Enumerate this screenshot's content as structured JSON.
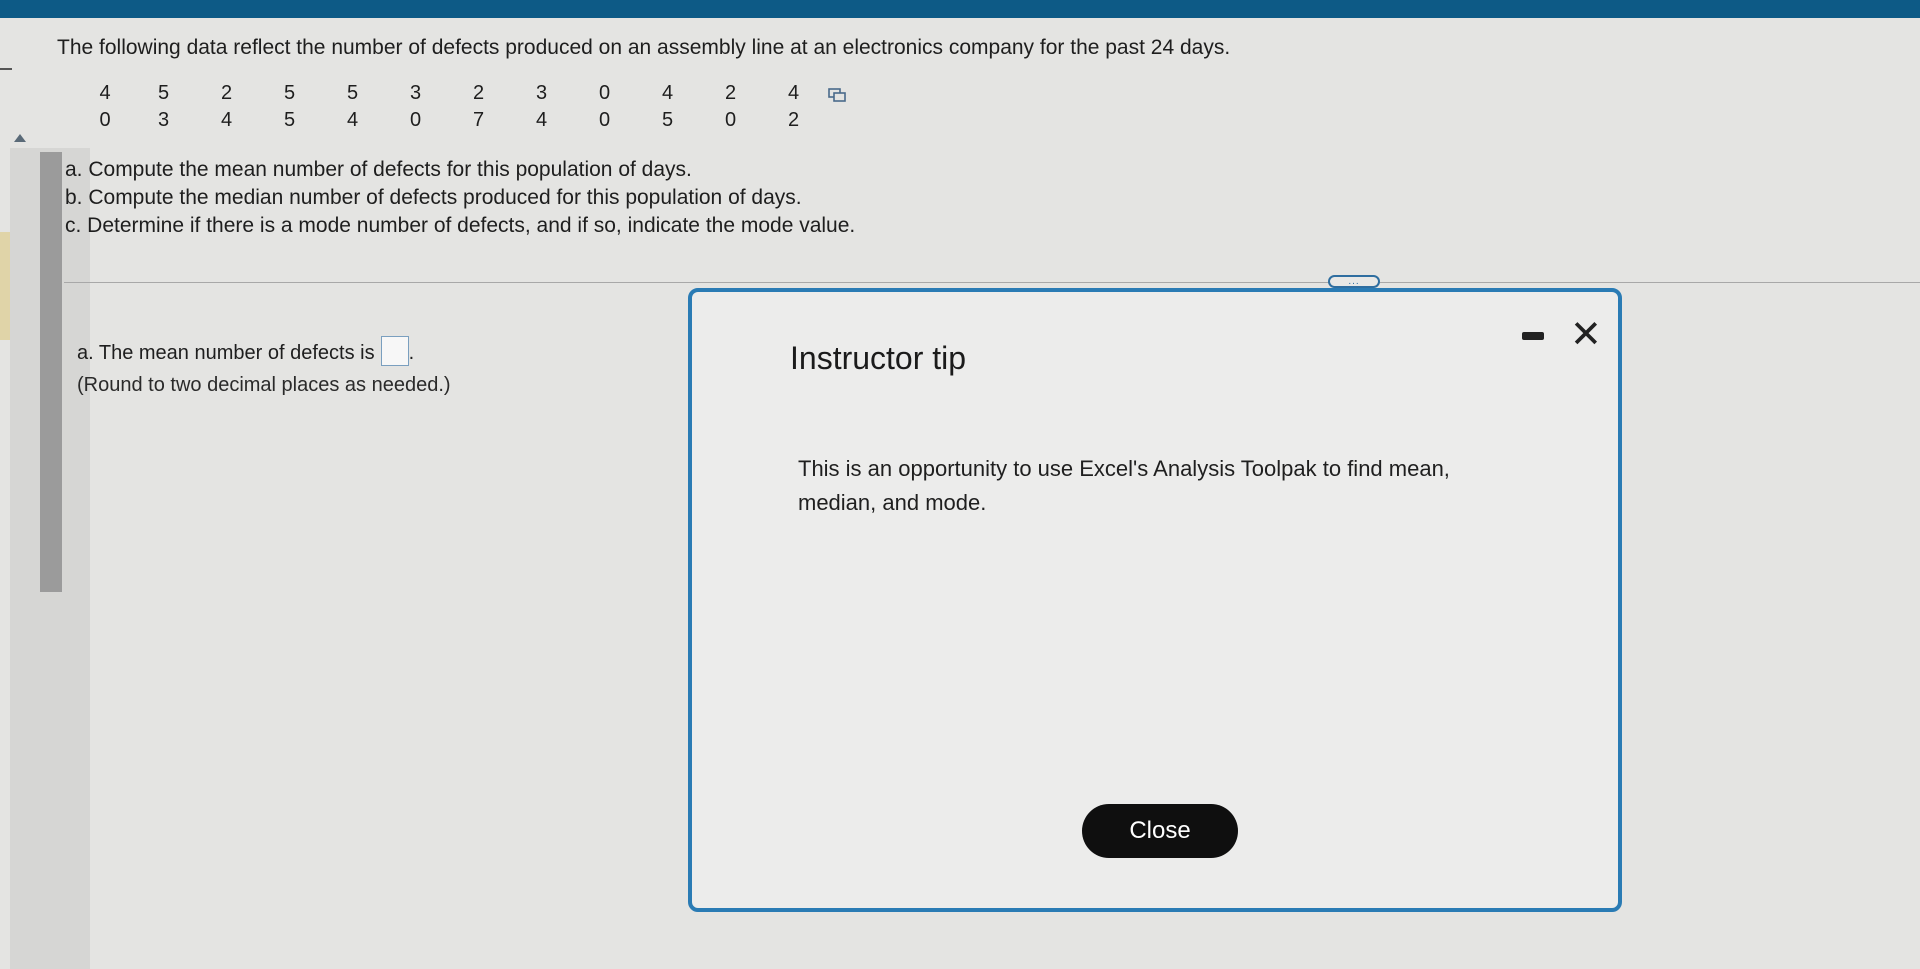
{
  "question": {
    "intro": "The following data reflect the number of defects produced on an assembly line at an electronics company for the past 24 days.",
    "data_rows": [
      [
        "4",
        "5",
        "2",
        "5",
        "5",
        "3",
        "2",
        "3",
        "0",
        "4",
        "2",
        "4"
      ],
      [
        "0",
        "3",
        "4",
        "5",
        "4",
        "0",
        "7",
        "4",
        "0",
        "5",
        "0",
        "2"
      ]
    ],
    "parts": [
      "a. Compute the mean number of defects for this population of days.",
      "b. Compute the median number of defects produced for this population of days.",
      "c. Determine if there is a mode number of defects, and if so, indicate the mode value."
    ]
  },
  "answer": {
    "prompt": "a. The mean number of defects is",
    "suffix": ".",
    "note": "(Round to two decimal places as needed.)"
  },
  "modal": {
    "handle_label": "...",
    "title": "Instructor tip",
    "body": "This is an opportunity to use Excel's Analysis Toolpak to find mean, median, and mode.",
    "close_label": "Close",
    "close_x": "✕"
  },
  "colors": {
    "topbar": "#0d5a86",
    "modal_border": "#2a7bb4",
    "button_bg": "#0f0f0f"
  }
}
